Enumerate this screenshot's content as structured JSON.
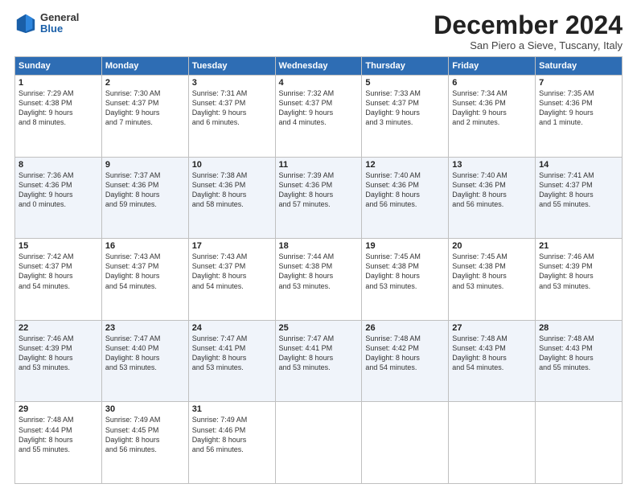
{
  "header": {
    "logo_line1": "General",
    "logo_line2": "Blue",
    "title": "December 2024",
    "location": "San Piero a Sieve, Tuscany, Italy"
  },
  "weekdays": [
    "Sunday",
    "Monday",
    "Tuesday",
    "Wednesday",
    "Thursday",
    "Friday",
    "Saturday"
  ],
  "weeks": [
    [
      {
        "day": "1",
        "info": "Sunrise: 7:29 AM\nSunset: 4:38 PM\nDaylight: 9 hours\nand 8 minutes."
      },
      {
        "day": "2",
        "info": "Sunrise: 7:30 AM\nSunset: 4:37 PM\nDaylight: 9 hours\nand 7 minutes."
      },
      {
        "day": "3",
        "info": "Sunrise: 7:31 AM\nSunset: 4:37 PM\nDaylight: 9 hours\nand 6 minutes."
      },
      {
        "day": "4",
        "info": "Sunrise: 7:32 AM\nSunset: 4:37 PM\nDaylight: 9 hours\nand 4 minutes."
      },
      {
        "day": "5",
        "info": "Sunrise: 7:33 AM\nSunset: 4:37 PM\nDaylight: 9 hours\nand 3 minutes."
      },
      {
        "day": "6",
        "info": "Sunrise: 7:34 AM\nSunset: 4:36 PM\nDaylight: 9 hours\nand 2 minutes."
      },
      {
        "day": "7",
        "info": "Sunrise: 7:35 AM\nSunset: 4:36 PM\nDaylight: 9 hours\nand 1 minute."
      }
    ],
    [
      {
        "day": "8",
        "info": "Sunrise: 7:36 AM\nSunset: 4:36 PM\nDaylight: 9 hours\nand 0 minutes."
      },
      {
        "day": "9",
        "info": "Sunrise: 7:37 AM\nSunset: 4:36 PM\nDaylight: 8 hours\nand 59 minutes."
      },
      {
        "day": "10",
        "info": "Sunrise: 7:38 AM\nSunset: 4:36 PM\nDaylight: 8 hours\nand 58 minutes."
      },
      {
        "day": "11",
        "info": "Sunrise: 7:39 AM\nSunset: 4:36 PM\nDaylight: 8 hours\nand 57 minutes."
      },
      {
        "day": "12",
        "info": "Sunrise: 7:40 AM\nSunset: 4:36 PM\nDaylight: 8 hours\nand 56 minutes."
      },
      {
        "day": "13",
        "info": "Sunrise: 7:40 AM\nSunset: 4:36 PM\nDaylight: 8 hours\nand 56 minutes."
      },
      {
        "day": "14",
        "info": "Sunrise: 7:41 AM\nSunset: 4:37 PM\nDaylight: 8 hours\nand 55 minutes."
      }
    ],
    [
      {
        "day": "15",
        "info": "Sunrise: 7:42 AM\nSunset: 4:37 PM\nDaylight: 8 hours\nand 54 minutes."
      },
      {
        "day": "16",
        "info": "Sunrise: 7:43 AM\nSunset: 4:37 PM\nDaylight: 8 hours\nand 54 minutes."
      },
      {
        "day": "17",
        "info": "Sunrise: 7:43 AM\nSunset: 4:37 PM\nDaylight: 8 hours\nand 54 minutes."
      },
      {
        "day": "18",
        "info": "Sunrise: 7:44 AM\nSunset: 4:38 PM\nDaylight: 8 hours\nand 53 minutes."
      },
      {
        "day": "19",
        "info": "Sunrise: 7:45 AM\nSunset: 4:38 PM\nDaylight: 8 hours\nand 53 minutes."
      },
      {
        "day": "20",
        "info": "Sunrise: 7:45 AM\nSunset: 4:38 PM\nDaylight: 8 hours\nand 53 minutes."
      },
      {
        "day": "21",
        "info": "Sunrise: 7:46 AM\nSunset: 4:39 PM\nDaylight: 8 hours\nand 53 minutes."
      }
    ],
    [
      {
        "day": "22",
        "info": "Sunrise: 7:46 AM\nSunset: 4:39 PM\nDaylight: 8 hours\nand 53 minutes."
      },
      {
        "day": "23",
        "info": "Sunrise: 7:47 AM\nSunset: 4:40 PM\nDaylight: 8 hours\nand 53 minutes."
      },
      {
        "day": "24",
        "info": "Sunrise: 7:47 AM\nSunset: 4:41 PM\nDaylight: 8 hours\nand 53 minutes."
      },
      {
        "day": "25",
        "info": "Sunrise: 7:47 AM\nSunset: 4:41 PM\nDaylight: 8 hours\nand 53 minutes."
      },
      {
        "day": "26",
        "info": "Sunrise: 7:48 AM\nSunset: 4:42 PM\nDaylight: 8 hours\nand 54 minutes."
      },
      {
        "day": "27",
        "info": "Sunrise: 7:48 AM\nSunset: 4:43 PM\nDaylight: 8 hours\nand 54 minutes."
      },
      {
        "day": "28",
        "info": "Sunrise: 7:48 AM\nSunset: 4:43 PM\nDaylight: 8 hours\nand 55 minutes."
      }
    ],
    [
      {
        "day": "29",
        "info": "Sunrise: 7:48 AM\nSunset: 4:44 PM\nDaylight: 8 hours\nand 55 minutes."
      },
      {
        "day": "30",
        "info": "Sunrise: 7:49 AM\nSunset: 4:45 PM\nDaylight: 8 hours\nand 56 minutes."
      },
      {
        "day": "31",
        "info": "Sunrise: 7:49 AM\nSunset: 4:46 PM\nDaylight: 8 hours\nand 56 minutes."
      },
      {
        "day": "",
        "info": ""
      },
      {
        "day": "",
        "info": ""
      },
      {
        "day": "",
        "info": ""
      },
      {
        "day": "",
        "info": ""
      }
    ]
  ]
}
